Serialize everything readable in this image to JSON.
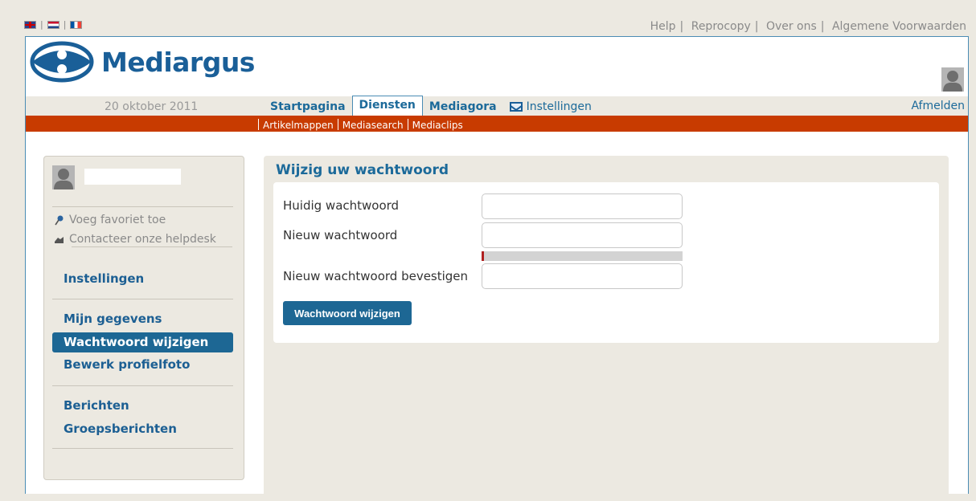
{
  "top": {
    "flags": [
      {
        "name": "english-flag-icon"
      },
      {
        "name": "dutch-flag-icon"
      },
      {
        "name": "french-flag-icon"
      }
    ],
    "links": [
      "Help",
      "Reprocopy",
      "Over ons",
      "Algemene Voorwaarden"
    ]
  },
  "brand": {
    "name": "Mediargus",
    "logo_color": "#1a5f98"
  },
  "nav": {
    "date": "20 oktober 2011",
    "tabs": [
      "Startpagina",
      "Diensten",
      "Mediagora",
      "Instellingen"
    ],
    "active_tab": "Diensten",
    "logout": "Afmelden",
    "sublinks": [
      "Artikelmappen",
      "Mediasearch",
      "Mediaclips"
    ],
    "accent": "#c83b00"
  },
  "sidebar": {
    "utility": [
      {
        "label": "Voeg favoriet toe",
        "icon": "pushpin-icon"
      },
      {
        "label": "Contacteer onze helpdesk",
        "icon": "helpdesk-icon"
      }
    ],
    "section_title": "Instellingen",
    "account_items": [
      "Mijn gegevens",
      "Wachtwoord wijzigen",
      "Bewerk profielfoto"
    ],
    "active_item": "Wachtwoord wijzigen",
    "message_items": [
      "Berichten",
      "Groepsberichten"
    ]
  },
  "form": {
    "title": "Wijzig uw wachtwoord",
    "current_label": "Huidig wachtwoord",
    "current_value": "",
    "new_label": "Nieuw wachtwoord",
    "new_value": "",
    "confirm_label": "Nieuw wachtwoord bevestigen",
    "confirm_value": "",
    "strength_fraction": 0.01,
    "submit_label": "Wachtwoord wijzigen"
  }
}
